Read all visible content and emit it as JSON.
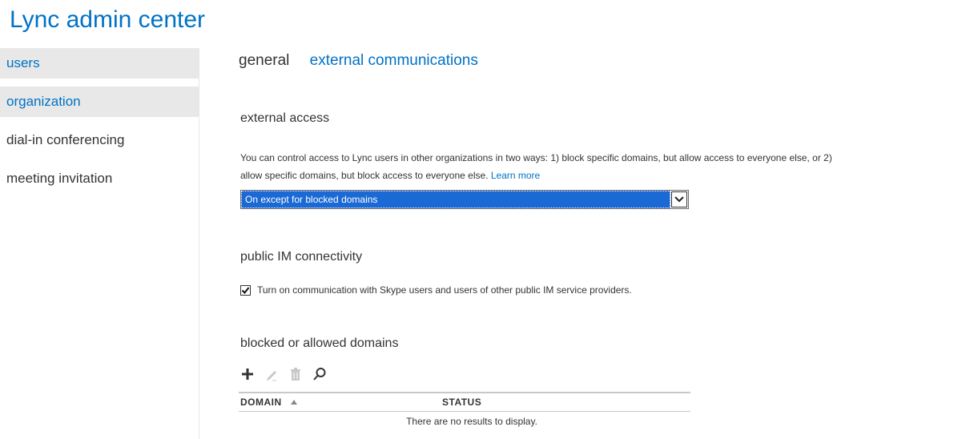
{
  "app": {
    "title": "Lync admin center"
  },
  "sidebar": {
    "items": [
      {
        "label": "users"
      },
      {
        "label": "organization"
      },
      {
        "label": "dial-in conferencing"
      },
      {
        "label": "meeting invitation"
      }
    ]
  },
  "tabs": [
    {
      "label": "general"
    },
    {
      "label": "external communications"
    }
  ],
  "external_access": {
    "heading": "external access",
    "description_line1": "You can control access to Lync users in other organizations in two ways: 1) block specific domains, but allow access to everyone else, or 2)",
    "description_line2": "allow specific domains, but block access to everyone else.",
    "learn_more": "Learn more",
    "select_value": "On except for blocked domains"
  },
  "public_im": {
    "heading": "public IM connectivity",
    "checkbox_label": "Turn on communication with Skype users and users of other public IM service providers.",
    "checked": true
  },
  "domains": {
    "heading": "blocked or allowed domains",
    "columns": {
      "domain": "DOMAIN",
      "status": "STATUS"
    },
    "empty_message": "There are no results to display.",
    "toolbar_icons": [
      "add-icon",
      "edit-icon",
      "delete-icon",
      "search-icon"
    ]
  },
  "colors": {
    "accent": "#0072c6",
    "nav_active_bg": "#e8e8e8",
    "select_highlight": "#1a69d5"
  }
}
